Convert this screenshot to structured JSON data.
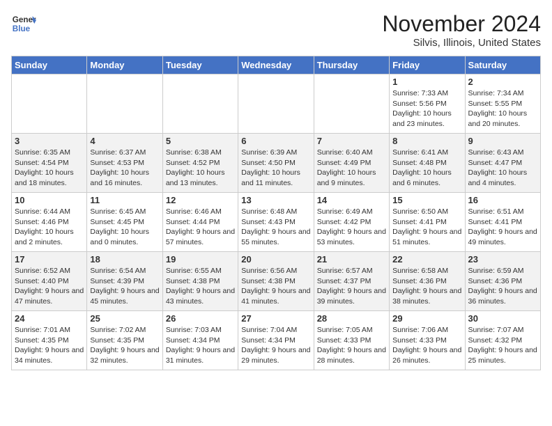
{
  "header": {
    "logo_general": "General",
    "logo_blue": "Blue",
    "month_year": "November 2024",
    "location": "Silvis, Illinois, United States"
  },
  "days_of_week": [
    "Sunday",
    "Monday",
    "Tuesday",
    "Wednesday",
    "Thursday",
    "Friday",
    "Saturday"
  ],
  "weeks": [
    [
      {
        "day": "",
        "info": ""
      },
      {
        "day": "",
        "info": ""
      },
      {
        "day": "",
        "info": ""
      },
      {
        "day": "",
        "info": ""
      },
      {
        "day": "",
        "info": ""
      },
      {
        "day": "1",
        "info": "Sunrise: 7:33 AM\nSunset: 5:56 PM\nDaylight: 10 hours and 23 minutes."
      },
      {
        "day": "2",
        "info": "Sunrise: 7:34 AM\nSunset: 5:55 PM\nDaylight: 10 hours and 20 minutes."
      }
    ],
    [
      {
        "day": "3",
        "info": "Sunrise: 6:35 AM\nSunset: 4:54 PM\nDaylight: 10 hours and 18 minutes."
      },
      {
        "day": "4",
        "info": "Sunrise: 6:37 AM\nSunset: 4:53 PM\nDaylight: 10 hours and 16 minutes."
      },
      {
        "day": "5",
        "info": "Sunrise: 6:38 AM\nSunset: 4:52 PM\nDaylight: 10 hours and 13 minutes."
      },
      {
        "day": "6",
        "info": "Sunrise: 6:39 AM\nSunset: 4:50 PM\nDaylight: 10 hours and 11 minutes."
      },
      {
        "day": "7",
        "info": "Sunrise: 6:40 AM\nSunset: 4:49 PM\nDaylight: 10 hours and 9 minutes."
      },
      {
        "day": "8",
        "info": "Sunrise: 6:41 AM\nSunset: 4:48 PM\nDaylight: 10 hours and 6 minutes."
      },
      {
        "day": "9",
        "info": "Sunrise: 6:43 AM\nSunset: 4:47 PM\nDaylight: 10 hours and 4 minutes."
      }
    ],
    [
      {
        "day": "10",
        "info": "Sunrise: 6:44 AM\nSunset: 4:46 PM\nDaylight: 10 hours and 2 minutes."
      },
      {
        "day": "11",
        "info": "Sunrise: 6:45 AM\nSunset: 4:45 PM\nDaylight: 10 hours and 0 minutes."
      },
      {
        "day": "12",
        "info": "Sunrise: 6:46 AM\nSunset: 4:44 PM\nDaylight: 9 hours and 57 minutes."
      },
      {
        "day": "13",
        "info": "Sunrise: 6:48 AM\nSunset: 4:43 PM\nDaylight: 9 hours and 55 minutes."
      },
      {
        "day": "14",
        "info": "Sunrise: 6:49 AM\nSunset: 4:42 PM\nDaylight: 9 hours and 53 minutes."
      },
      {
        "day": "15",
        "info": "Sunrise: 6:50 AM\nSunset: 4:41 PM\nDaylight: 9 hours and 51 minutes."
      },
      {
        "day": "16",
        "info": "Sunrise: 6:51 AM\nSunset: 4:41 PM\nDaylight: 9 hours and 49 minutes."
      }
    ],
    [
      {
        "day": "17",
        "info": "Sunrise: 6:52 AM\nSunset: 4:40 PM\nDaylight: 9 hours and 47 minutes."
      },
      {
        "day": "18",
        "info": "Sunrise: 6:54 AM\nSunset: 4:39 PM\nDaylight: 9 hours and 45 minutes."
      },
      {
        "day": "19",
        "info": "Sunrise: 6:55 AM\nSunset: 4:38 PM\nDaylight: 9 hours and 43 minutes."
      },
      {
        "day": "20",
        "info": "Sunrise: 6:56 AM\nSunset: 4:38 PM\nDaylight: 9 hours and 41 minutes."
      },
      {
        "day": "21",
        "info": "Sunrise: 6:57 AM\nSunset: 4:37 PM\nDaylight: 9 hours and 39 minutes."
      },
      {
        "day": "22",
        "info": "Sunrise: 6:58 AM\nSunset: 4:36 PM\nDaylight: 9 hours and 38 minutes."
      },
      {
        "day": "23",
        "info": "Sunrise: 6:59 AM\nSunset: 4:36 PM\nDaylight: 9 hours and 36 minutes."
      }
    ],
    [
      {
        "day": "24",
        "info": "Sunrise: 7:01 AM\nSunset: 4:35 PM\nDaylight: 9 hours and 34 minutes."
      },
      {
        "day": "25",
        "info": "Sunrise: 7:02 AM\nSunset: 4:35 PM\nDaylight: 9 hours and 32 minutes."
      },
      {
        "day": "26",
        "info": "Sunrise: 7:03 AM\nSunset: 4:34 PM\nDaylight: 9 hours and 31 minutes."
      },
      {
        "day": "27",
        "info": "Sunrise: 7:04 AM\nSunset: 4:34 PM\nDaylight: 9 hours and 29 minutes."
      },
      {
        "day": "28",
        "info": "Sunrise: 7:05 AM\nSunset: 4:33 PM\nDaylight: 9 hours and 28 minutes."
      },
      {
        "day": "29",
        "info": "Sunrise: 7:06 AM\nSunset: 4:33 PM\nDaylight: 9 hours and 26 minutes."
      },
      {
        "day": "30",
        "info": "Sunrise: 7:07 AM\nSunset: 4:32 PM\nDaylight: 9 hours and 25 minutes."
      }
    ]
  ],
  "alt_rows": [
    1,
    3
  ]
}
